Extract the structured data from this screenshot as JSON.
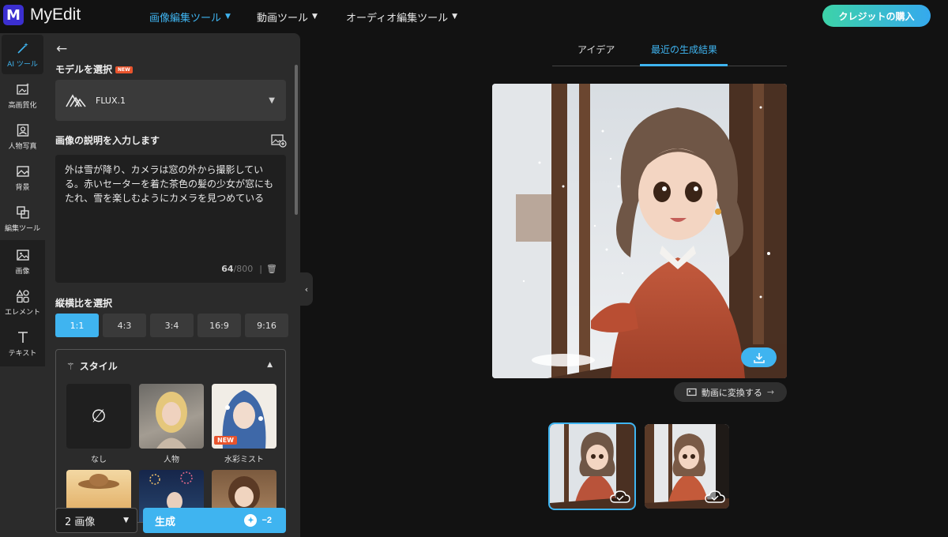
{
  "app": {
    "logo_letter": "M",
    "name": "MyEdit"
  },
  "nav": {
    "items": [
      {
        "label": "画像編集ツール",
        "active": true
      },
      {
        "label": "動画ツール",
        "active": false
      },
      {
        "label": "オーディオ編集ツール",
        "active": false
      }
    ],
    "buy_label": "クレジットの購入"
  },
  "rail": {
    "items": [
      {
        "label": "AI ツール",
        "icon": "magic-wand-icon"
      },
      {
        "label": "高画質化",
        "icon": "enhance-icon"
      },
      {
        "label": "人物写真",
        "icon": "portrait-icon"
      },
      {
        "label": "背景",
        "icon": "background-icon"
      },
      {
        "label": "編集ツール",
        "icon": "edit-tools-icon"
      },
      {
        "label": "画像",
        "icon": "image-icon"
      },
      {
        "label": "エレメント",
        "icon": "elements-icon"
      },
      {
        "label": "テキスト",
        "icon": "text-icon"
      }
    ]
  },
  "panel": {
    "model_label": "モデルを選択",
    "new_badge": "NEW",
    "model_name": "FLUX.1",
    "prompt_label": "画像の説明を入力します",
    "prompt_text": "外は雪が降り、カメラは窓の外から撮影している。赤いセーターを着た茶色の髪の少女が窓にもたれ、雪を楽しむようにカメラを見つめている",
    "char_count": "64",
    "char_max": "/800",
    "ratio_label": "縦横比を選択",
    "ratios": [
      "1:1",
      "4:3",
      "3:4",
      "16:9",
      "9:16"
    ],
    "style_label": "スタイル",
    "styles": [
      {
        "label": "なし"
      },
      {
        "label": "人物"
      },
      {
        "label": "水彩ミスト",
        "badge": "NEW"
      }
    ],
    "count_value": "2 画像",
    "generate_label": "生成",
    "generate_cost": "−2"
  },
  "results": {
    "tabs": [
      "アイデア",
      "最近の生成結果"
    ],
    "active_tab": 1,
    "video_button": "動画に変換する"
  },
  "colors": {
    "accent": "#3fb4f0",
    "background": "#121212",
    "panel": "#2b2b2b"
  }
}
